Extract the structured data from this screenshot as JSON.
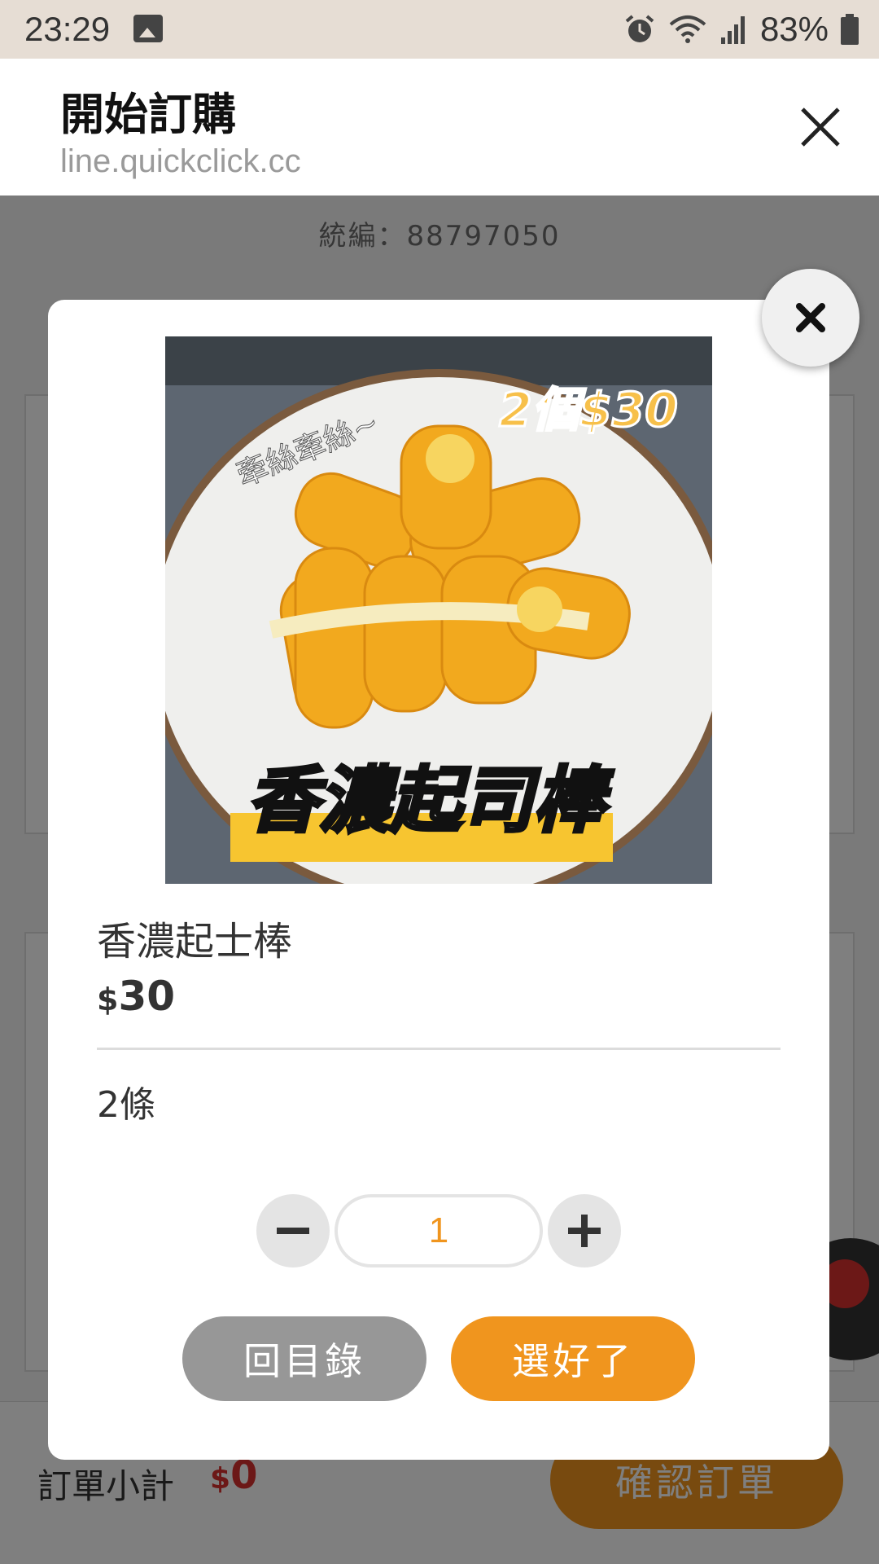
{
  "status_bar": {
    "time": "23:29",
    "battery": "83%",
    "icons": [
      "image-icon",
      "alarm-icon",
      "wifi-icon",
      "signal-icon",
      "battery-icon"
    ]
  },
  "browser": {
    "title": "開始訂購",
    "url": "line.quickclick.cc",
    "close_icon": "close-icon"
  },
  "background_page": {
    "tax_id": "統編：88797050",
    "subtotal_label": "訂單小計",
    "subtotal_currency": "$",
    "subtotal_value": "0",
    "confirm_label": "確認訂單"
  },
  "modal": {
    "close_icon": "close-icon",
    "image_texts": {
      "promo": "2個$30",
      "tagline": "牽絲牽絲~",
      "caption": "香濃起司棒"
    },
    "product_name": "香濃起士棒",
    "currency": "$",
    "price": "30",
    "description": "2條",
    "quantity": "1",
    "back_label": "回目錄",
    "done_label": "選好了"
  },
  "colors": {
    "accent": "#f0951e",
    "status_bar_bg": "#e6ddd4",
    "price_red": "#d9312f",
    "secondary_button": "#979797"
  }
}
